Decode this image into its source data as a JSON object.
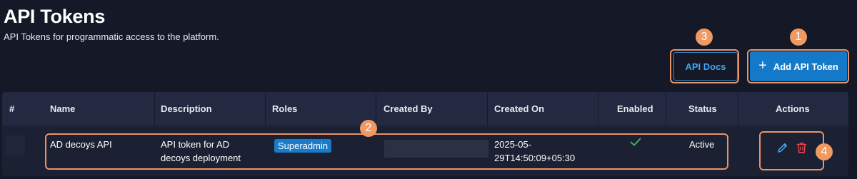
{
  "header": {
    "title": "API Tokens",
    "subtitle": "API Tokens for programmatic access to the platform."
  },
  "toolbar": {
    "docs_label": "API Docs",
    "add_label": "Add API Token",
    "add_icon": "plus-icon"
  },
  "table": {
    "columns": [
      "#",
      "Name",
      "Description",
      "Roles",
      "Created By",
      "Created On",
      "Enabled",
      "Status",
      "Actions"
    ],
    "rows": [
      {
        "index": "",
        "name": "AD decoys API",
        "description_line1": "API token for AD",
        "description_line2": "decoys deployment",
        "role": "Superadmin",
        "created_by": "",
        "created_on_line1": "2025-05-",
        "created_on_line2": "29T14:50:09+05:30",
        "enabled": true,
        "status": "Active",
        "actions": [
          "pencil-icon",
          "trash-icon"
        ]
      }
    ]
  },
  "annotations": {
    "labels": [
      "1",
      "2",
      "3",
      "4"
    ]
  },
  "colors": {
    "background": "#141827",
    "primary": "#1479c9",
    "link": "#3ea6f0",
    "callout": "#ef9a63",
    "success": "#3fbf5a",
    "danger": "#e0424a"
  }
}
